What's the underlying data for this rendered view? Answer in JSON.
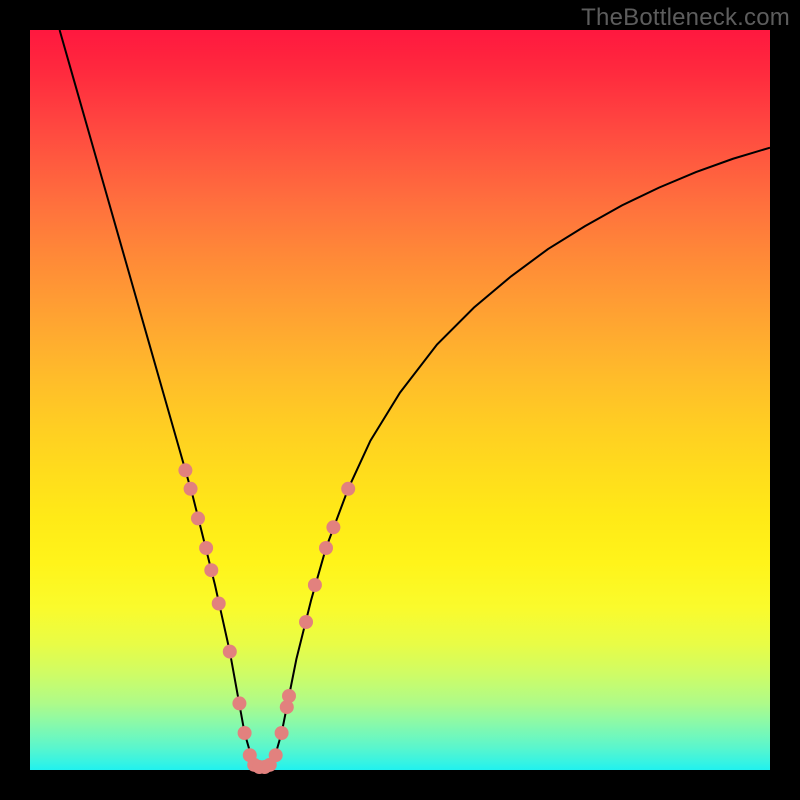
{
  "watermark": "TheBottleneck.com",
  "chart_data": {
    "type": "line",
    "title": "",
    "xlabel": "",
    "ylabel": "",
    "xlim": [
      0,
      100
    ],
    "ylim": [
      0,
      100
    ],
    "series": [
      {
        "name": "curve",
        "color": "#000000",
        "width": 2,
        "x": [
          4,
          6,
          8,
          10,
          12,
          14,
          16,
          18,
          20,
          21,
          22,
          23,
          24,
          25,
          26,
          27,
          28,
          29,
          30,
          31,
          32,
          33,
          34,
          35,
          36,
          38,
          40,
          43,
          46,
          50,
          55,
          60,
          65,
          70,
          75,
          80,
          85,
          90,
          95,
          100
        ],
        "y": [
          100,
          93,
          86,
          79,
          72,
          65,
          58,
          51,
          44,
          40.5,
          37,
          33,
          29,
          25,
          20.5,
          16,
          10.5,
          5,
          1.5,
          0.5,
          0.5,
          1.5,
          5,
          10,
          15,
          23,
          30,
          38,
          44.5,
          51,
          57.5,
          62.5,
          66.7,
          70.4,
          73.5,
          76.3,
          78.7,
          80.8,
          82.6,
          84.1
        ]
      }
    ],
    "markers": {
      "name": "dots",
      "color": "#e2817e",
      "radius": 7,
      "points_xy": [
        [
          21.0,
          40.5
        ],
        [
          21.7,
          38.0
        ],
        [
          22.7,
          34.0
        ],
        [
          23.8,
          30.0
        ],
        [
          24.5,
          27.0
        ],
        [
          25.5,
          22.5
        ],
        [
          27.0,
          16.0
        ],
        [
          28.3,
          9.0
        ],
        [
          29.0,
          5.0
        ],
        [
          29.7,
          2.0
        ],
        [
          30.3,
          0.7
        ],
        [
          31.0,
          0.4
        ],
        [
          31.7,
          0.4
        ],
        [
          32.4,
          0.7
        ],
        [
          33.2,
          2.0
        ],
        [
          34.0,
          5.0
        ],
        [
          34.7,
          8.5
        ],
        [
          35.0,
          10.0
        ],
        [
          37.3,
          20.0
        ],
        [
          38.5,
          25.0
        ],
        [
          40.0,
          30.0
        ],
        [
          41.0,
          32.8
        ],
        [
          43.0,
          38.0
        ]
      ]
    }
  }
}
